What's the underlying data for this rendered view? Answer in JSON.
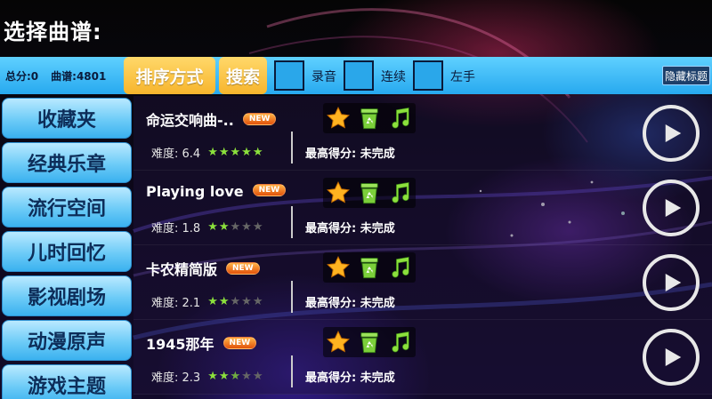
{
  "header": {
    "title": "选择曲谱:"
  },
  "toolbar": {
    "total_score": "总分:0",
    "song_count": "曲谱:4801",
    "sort_label": "排序方式",
    "search_label": "搜索",
    "record_label": "录音",
    "continuous_label": "连续",
    "left_hand_label": "左手",
    "hide_title_label": "隐藏标题"
  },
  "sidebar": {
    "items": [
      {
        "label": "收藏夹"
      },
      {
        "label": "经典乐章"
      },
      {
        "label": "流行空间"
      },
      {
        "label": "儿时回忆"
      },
      {
        "label": "影视剧场"
      },
      {
        "label": "动漫原声"
      },
      {
        "label": "游戏主题"
      }
    ]
  },
  "songs": [
    {
      "title": "命运交响曲-..",
      "badge": "NEW",
      "difficulty": "难度: 6.4",
      "rating": 5,
      "best_score": "最高得分: 未完成"
    },
    {
      "title": "Playing love",
      "badge": "NEW",
      "difficulty": "难度: 1.8",
      "rating": 2,
      "best_score": "最高得分: 未完成"
    },
    {
      "title": "卡农精简版",
      "badge": "NEW",
      "difficulty": "难度: 2.1",
      "rating": 2,
      "best_score": "最高得分: 未完成"
    },
    {
      "title": "1945那年",
      "badge": "NEW",
      "difficulty": "难度: 2.3",
      "rating": 2.5,
      "best_score": "最高得分: 未完成"
    }
  ],
  "colors": {
    "toolbar": "#27a9ef",
    "accent_orange": "#f7b52d",
    "star_green": "#8be03c"
  },
  "icons": {
    "favorite": "star-icon",
    "recycle": "recycle-bin-icon",
    "music": "music-note-icon",
    "play": "play-icon"
  }
}
